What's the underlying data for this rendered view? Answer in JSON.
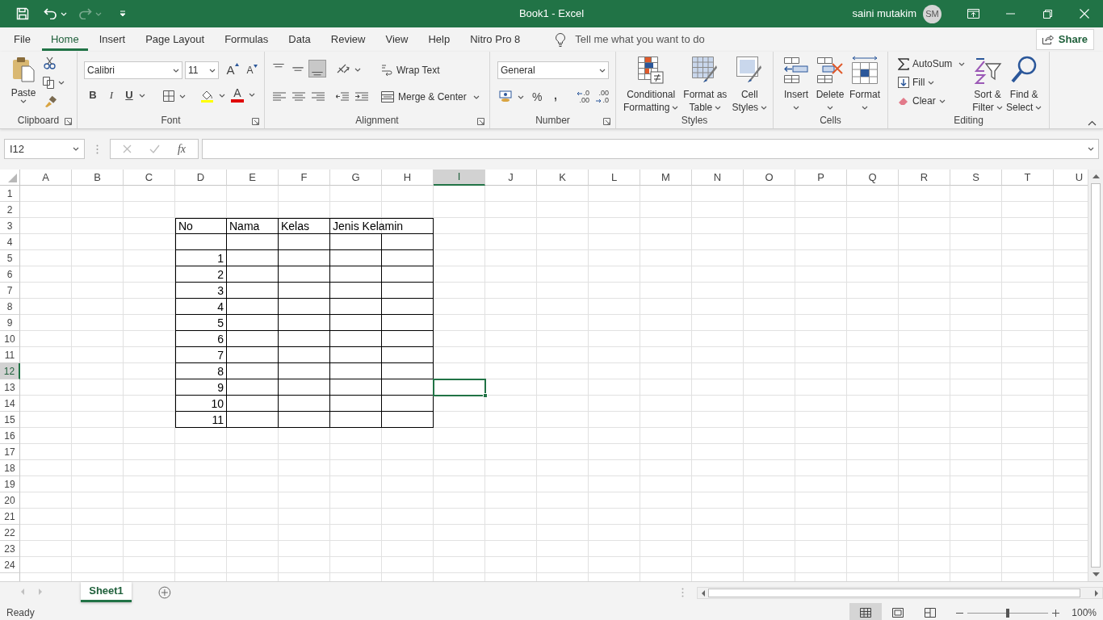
{
  "title_bar": {
    "title": "Book1  -  Excel",
    "user": "saini mutakim",
    "initials": "SM"
  },
  "menu_tabs": [
    {
      "label": "File",
      "selected": false
    },
    {
      "label": "Home",
      "selected": true
    },
    {
      "label": "Insert",
      "selected": false
    },
    {
      "label": "Page Layout",
      "selected": false
    },
    {
      "label": "Formulas",
      "selected": false
    },
    {
      "label": "Data",
      "selected": false
    },
    {
      "label": "Review",
      "selected": false
    },
    {
      "label": "View",
      "selected": false
    },
    {
      "label": "Help",
      "selected": false
    },
    {
      "label": "Nitro Pro 8",
      "selected": false
    }
  ],
  "tell_me": {
    "placeholder": "Tell me what you want to do"
  },
  "share": "Share",
  "ribbon": {
    "clipboard": {
      "label": "Clipboard",
      "paste": "Paste"
    },
    "font": {
      "label": "Font",
      "font_name": "Calibri",
      "font_size": "11",
      "grow": "A",
      "shrink": "A",
      "bold": "B",
      "italic": "I",
      "underline": "U",
      "font_color": "A"
    },
    "alignment": {
      "label": "Alignment",
      "wrap_text": "Wrap Text",
      "merge": "Merge & Center",
      "vertical_align": [
        {
          "kind": "top",
          "selected": false
        },
        {
          "kind": "middle",
          "selected": false
        },
        {
          "kind": "bottom",
          "selected": true
        }
      ]
    },
    "number": {
      "label": "Number",
      "format": "General",
      "percent": "%",
      "comma": ",",
      "increase_decimal": [
        ".0",
        ".00"
      ],
      "decrease_decimal": [
        ".00",
        ".0"
      ]
    },
    "styles": {
      "label": "Styles",
      "buttons": [
        {
          "lines": [
            "Conditional",
            "Formatting"
          ]
        },
        {
          "lines": [
            "Format as",
            "Table"
          ]
        },
        {
          "lines": [
            "Cell",
            "Styles"
          ]
        }
      ]
    },
    "cells": {
      "label": "Cells",
      "buttons": [
        {
          "lines": [
            "Insert"
          ]
        },
        {
          "lines": [
            "Delete"
          ]
        },
        {
          "lines": [
            "Format"
          ]
        }
      ]
    },
    "editing": {
      "label": "Editing",
      "autosum": "AutoSum",
      "fill": "Fill",
      "clear": "Clear",
      "buttons": [
        {
          "lines": [
            "Sort &",
            "Filter"
          ]
        },
        {
          "lines": [
            "Find &",
            "Select"
          ]
        }
      ]
    }
  },
  "formula_bar": {
    "name_box": "I12",
    "function_label": "fx"
  },
  "grid": {
    "columns": [
      {
        "label": "A",
        "selected": false
      },
      {
        "label": "B",
        "selected": false
      },
      {
        "label": "C",
        "selected": false
      },
      {
        "label": "D",
        "selected": false
      },
      {
        "label": "E",
        "selected": false
      },
      {
        "label": "F",
        "selected": false
      },
      {
        "label": "G",
        "selected": false
      },
      {
        "label": "H",
        "selected": false
      },
      {
        "label": "I",
        "selected": true
      },
      {
        "label": "J",
        "selected": false
      },
      {
        "label": "K",
        "selected": false
      },
      {
        "label": "L",
        "selected": false
      },
      {
        "label": "M",
        "selected": false
      },
      {
        "label": "N",
        "selected": false
      },
      {
        "label": "O",
        "selected": false
      },
      {
        "label": "P",
        "selected": false
      },
      {
        "label": "Q",
        "selected": false
      },
      {
        "label": "R",
        "selected": false
      },
      {
        "label": "S",
        "selected": false
      },
      {
        "label": "T",
        "selected": false
      },
      {
        "label": "U",
        "selected": false
      }
    ],
    "rows": [
      {
        "label": "1",
        "selected": false
      },
      {
        "label": "2",
        "selected": false
      },
      {
        "label": "3",
        "selected": false
      },
      {
        "label": "4",
        "selected": false
      },
      {
        "label": "5",
        "selected": false
      },
      {
        "label": "6",
        "selected": false
      },
      {
        "label": "7",
        "selected": false
      },
      {
        "label": "8",
        "selected": false
      },
      {
        "label": "9",
        "selected": false
      },
      {
        "label": "10",
        "selected": false
      },
      {
        "label": "11",
        "selected": false
      },
      {
        "label": "12",
        "selected": true
      },
      {
        "label": "13",
        "selected": false
      },
      {
        "label": "14",
        "selected": false
      },
      {
        "label": "15",
        "selected": false
      },
      {
        "label": "16",
        "selected": false
      },
      {
        "label": "17",
        "selected": false
      },
      {
        "label": "18",
        "selected": false
      },
      {
        "label": "19",
        "selected": false
      },
      {
        "label": "20",
        "selected": false
      },
      {
        "label": "21",
        "selected": false
      },
      {
        "label": "22",
        "selected": false
      },
      {
        "label": "23",
        "selected": false
      },
      {
        "label": "24",
        "selected": false
      }
    ],
    "table": {
      "header": [
        "No",
        "Nama",
        "Kelas",
        "Jenis Kelamin"
      ],
      "numbers": [
        "1",
        "2",
        "3",
        "4",
        "5",
        "6",
        "7",
        "8",
        "9",
        "10",
        "11"
      ]
    }
  },
  "sheets": [
    {
      "name": "Sheet1",
      "selected": true
    }
  ],
  "status_bar": {
    "text": "Ready",
    "views": [
      {
        "kind": "normal",
        "selected": true
      },
      {
        "kind": "page_layout",
        "selected": false
      },
      {
        "kind": "page_break",
        "selected": false
      }
    ],
    "zoom": {
      "level": 0.5,
      "reading": "100%"
    }
  }
}
